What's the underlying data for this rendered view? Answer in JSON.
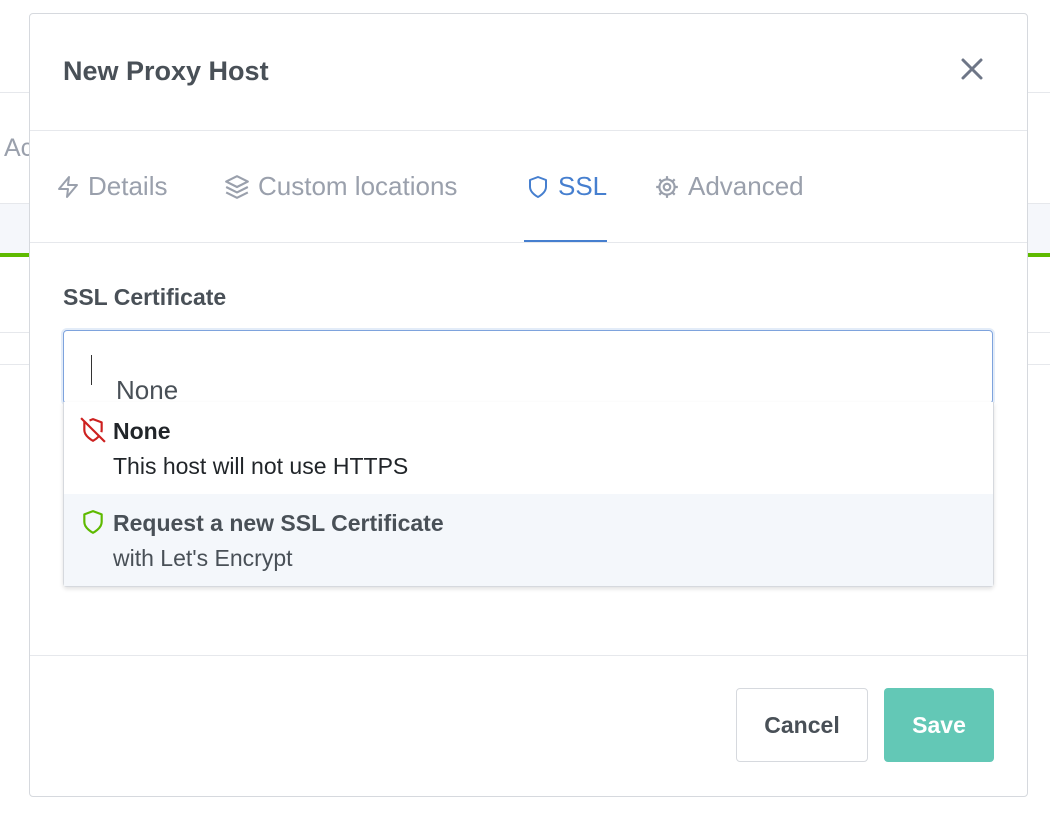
{
  "background": {
    "partial_text": "Ac"
  },
  "modal": {
    "title": "New Proxy Host",
    "tabs": [
      {
        "label": "Details",
        "icon": "zap-icon"
      },
      {
        "label": "Custom locations",
        "icon": "layers-icon"
      },
      {
        "label": "SSL",
        "icon": "shield-icon",
        "active": true
      },
      {
        "label": "Advanced",
        "icon": "gear-icon"
      }
    ],
    "ssl": {
      "label": "SSL Certificate",
      "value": "None",
      "options": [
        {
          "title": "None",
          "subtitle": "This host will not use HTTPS",
          "icon": "shield-off-icon",
          "color": "#cd201f"
        },
        {
          "title": "Request a new SSL Certificate",
          "subtitle": "with Let's Encrypt",
          "icon": "shield-icon",
          "color": "#5eba00",
          "highlighted": true
        }
      ]
    },
    "buttons": {
      "cancel": "Cancel",
      "save": "Save"
    }
  },
  "colors": {
    "accent": "#467fcf",
    "save": "#63c8b6"
  }
}
